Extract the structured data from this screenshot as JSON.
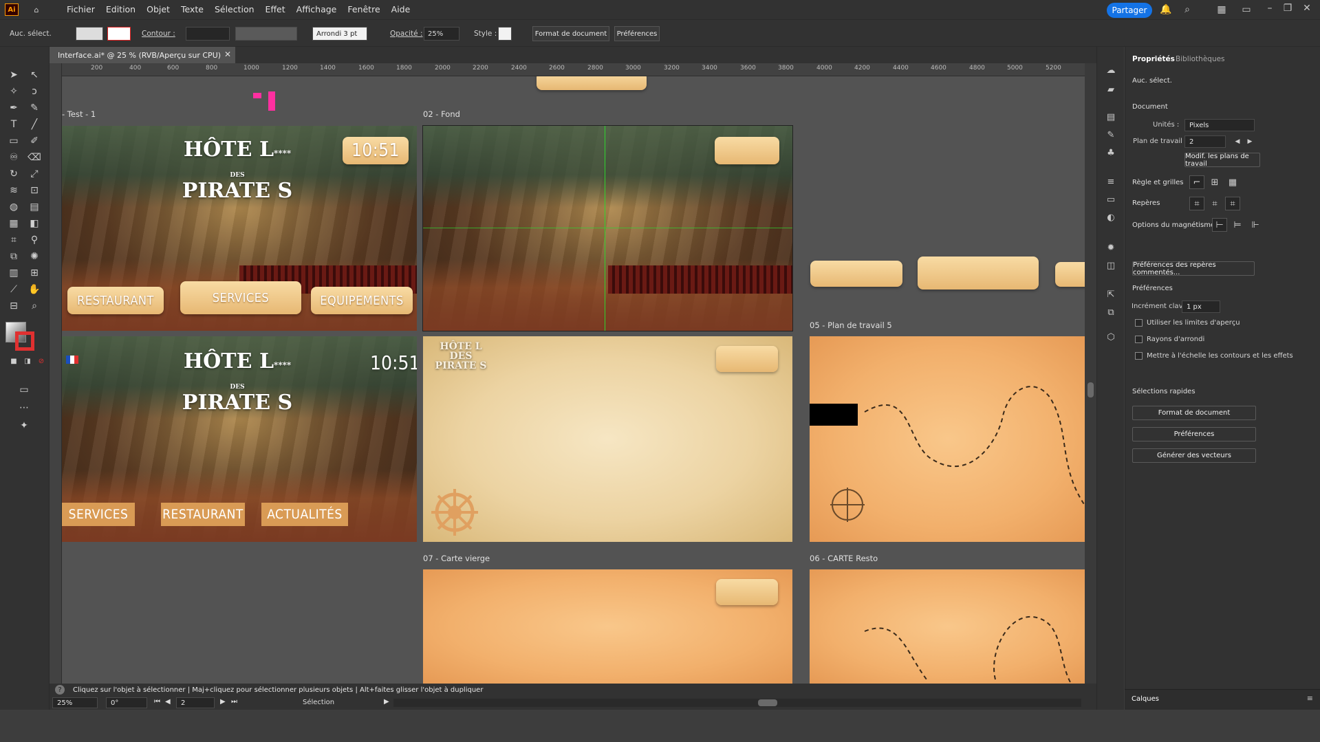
{
  "menu": [
    "Fichier",
    "Edition",
    "Objet",
    "Texte",
    "Sélection",
    "Effet",
    "Affichage",
    "Fenêtre",
    "Aide"
  ],
  "app_badge": "Ai",
  "share_label": "Partager",
  "control": {
    "selection_state": "Auc. sélect.",
    "stroke_label": "Contour :",
    "brush_label": "Arrondi 3 pt",
    "opacity_label": "Opacité :",
    "opacity_value": "25%",
    "style_label": "Style :",
    "format_button": "Format de document",
    "prefs_button": "Préférences"
  },
  "doc_tab": "Interface.ai* @ 25 % (RVB/Aperçu sur CPU)",
  "ruler_h": [
    "200",
    "400",
    "600",
    "800",
    "1000",
    "1200",
    "1400",
    "1600",
    "1800",
    "2000",
    "2200",
    "2400",
    "2600",
    "2800",
    "3000",
    "3200",
    "3400",
    "3600",
    "3800",
    "4000",
    "4200",
    "4400",
    "4600",
    "4800",
    "5000",
    "5200"
  ],
  "artboards": {
    "a1_label": "- Test - 1",
    "a2_label": "02 - Fond",
    "a5_label": "05 - Plan de travail 5",
    "a7_label": "07 - Carte vierge",
    "a6_label": "06 - CARTE Resto"
  },
  "design": {
    "logo_line1": "HÔTE L",
    "logo_stars": "****",
    "logo_des": "DES",
    "logo_line2": "PIRATE S",
    "time1": "10:51",
    "time2": "10:51",
    "btn_restaurant": "RESTAURANT",
    "btn_services": "SERVICES",
    "btn_equipements": "EQUIPEMENTS",
    "btn2_services": "SERVICES",
    "btn2_restaurant": "RESTAURANT",
    "btn2_actualites": "ACTUALITÉS",
    "small_logo": "HÔTE L DES PIRATE S"
  },
  "panel": {
    "tab_props": "Propriétés",
    "tab_libs": "Bibliothèques",
    "no_selection": "Auc. sélect.",
    "document_label": "Document",
    "units_label": "Unités :",
    "units_value": "Pixels",
    "artboard_label": "Plan de travail :",
    "artboard_value": "2",
    "edit_artboards": "Modif. les plans de travail",
    "rulers_grids": "Règle et grilles",
    "guides": "Repères",
    "snap_options": "Options du magnétisme",
    "smart_guides_prefs": "Préférences des repères commentés...",
    "preferences": "Préférences",
    "keyboard_increment": "Incrément clavier :",
    "keyboard_value": "1 px",
    "chk_preview_bounds": "Utiliser les limites d'aperçu",
    "chk_corners": "Rayons d'arrondi",
    "chk_scale": "Mettre à l'échelle les contours et les effets",
    "quick_actions": "Sélections rapides",
    "qa_format": "Format de document",
    "qa_prefs": "Préférences",
    "qa_vectors": "Générer des vecteurs",
    "layers": "Calques"
  },
  "status": "Cliquez sur l'objet à sélectionner  |  Maj+cliquez pour sélectionner plusieurs objets  |  Alt+faites glisser l'objet à dupliquer",
  "nav": {
    "zoom": "25%",
    "rotation": "0°",
    "artboard_num": "2",
    "mode": "Sélection"
  }
}
